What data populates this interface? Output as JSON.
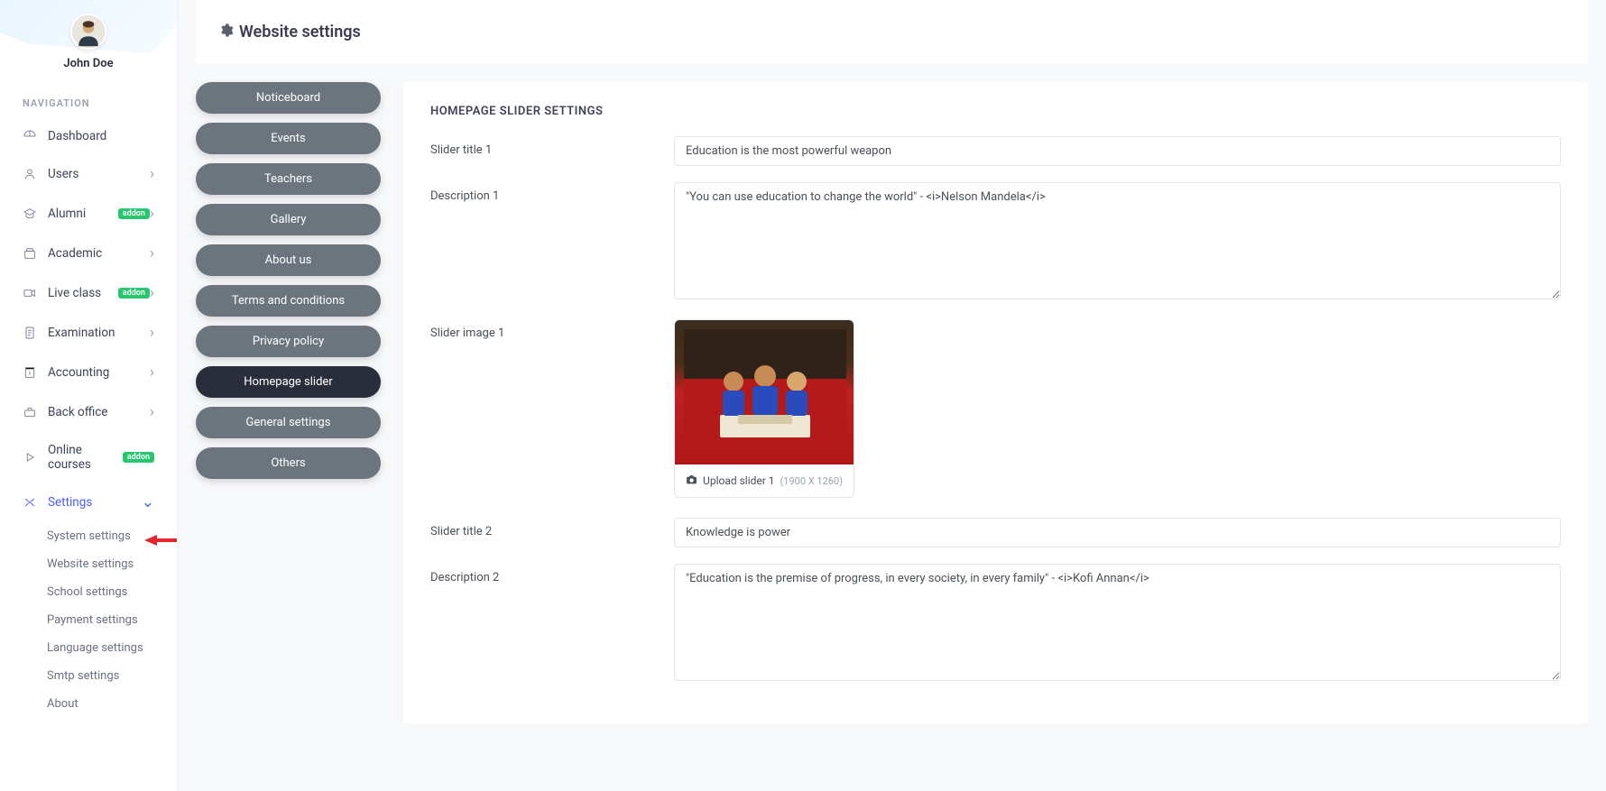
{
  "sidebar": {
    "username": "John Doe",
    "nav_header": "NAVIGATION",
    "items": [
      {
        "label": "Dashboard",
        "icon": "dashboard",
        "chev": false
      },
      {
        "label": "Users",
        "icon": "users",
        "chev": true
      },
      {
        "label": "Alumni",
        "icon": "alumni",
        "chev": true,
        "badge": "addon"
      },
      {
        "label": "Academic",
        "icon": "academic",
        "chev": true
      },
      {
        "label": "Live class",
        "icon": "liveclass",
        "chev": true,
        "badge": "addon"
      },
      {
        "label": "Examination",
        "icon": "exam",
        "chev": true
      },
      {
        "label": "Accounting",
        "icon": "accounting",
        "chev": true
      },
      {
        "label": "Back office",
        "icon": "backoffice",
        "chev": true
      },
      {
        "label": "Online courses",
        "icon": "courses",
        "chev": false,
        "badon": "addon",
        "badge": "addon"
      },
      {
        "label": "Settings",
        "icon": "settings",
        "chev": true,
        "active": true
      }
    ],
    "sub_items": [
      "System settings",
      "Website settings",
      "School settings",
      "Payment settings",
      "Language settings",
      "Smtp settings",
      "About"
    ]
  },
  "header": {
    "title": "Website settings"
  },
  "tabs": [
    "Noticeboard",
    "Events",
    "Teachers",
    "Gallery",
    "About us",
    "Terms and conditions",
    "Privacy policy",
    "Homepage slider",
    "General settings",
    "Others"
  ],
  "active_tab": "Homepage slider",
  "form": {
    "section_title": "HOMEPAGE SLIDER SETTINGS",
    "rows": {
      "slider_title_1": {
        "label": "Slider title 1",
        "value": "Education is the most powerful weapon"
      },
      "description_1": {
        "label": "Description 1",
        "value": "\"You can use education to change the world\" - <i>Nelson Mandela</i>"
      },
      "slider_image_1": {
        "label": "Slider image 1",
        "upload_label": "Upload slider 1",
        "dims": "(1900 X 1260)"
      },
      "slider_title_2": {
        "label": "Slider title 2",
        "value": "Knowledge is power"
      },
      "description_2": {
        "label": "Description 2",
        "value": "\"Education is the premise of progress, in every society, in every family\" - <i>Kofi Annan</i>"
      }
    }
  }
}
